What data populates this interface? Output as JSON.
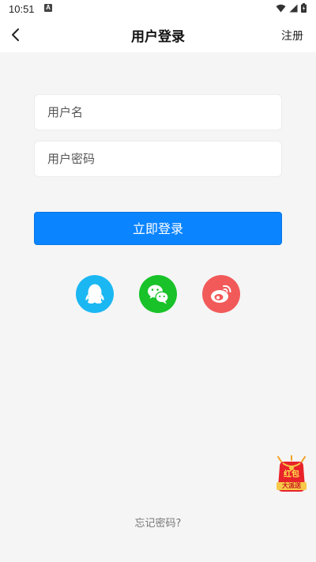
{
  "status_bar": {
    "time": "10:51",
    "notification_letter": "A"
  },
  "nav": {
    "title": "用户登录",
    "register": "注册"
  },
  "form": {
    "username_placeholder": "用户名",
    "password_placeholder": "用户密码",
    "login_button": "立即登录"
  },
  "social": [
    {
      "name": "qq-icon",
      "color": "#1bb7f3"
    },
    {
      "name": "wechat-icon",
      "color": "#19c229"
    },
    {
      "name": "weibo-icon",
      "color": "#f25a5a"
    }
  ],
  "promo": {
    "line1": "红包",
    "line2": "大派送"
  },
  "forgot_password": "忘记密码?",
  "colors": {
    "accent": "#0a84ff",
    "background": "#f5f5f5"
  }
}
